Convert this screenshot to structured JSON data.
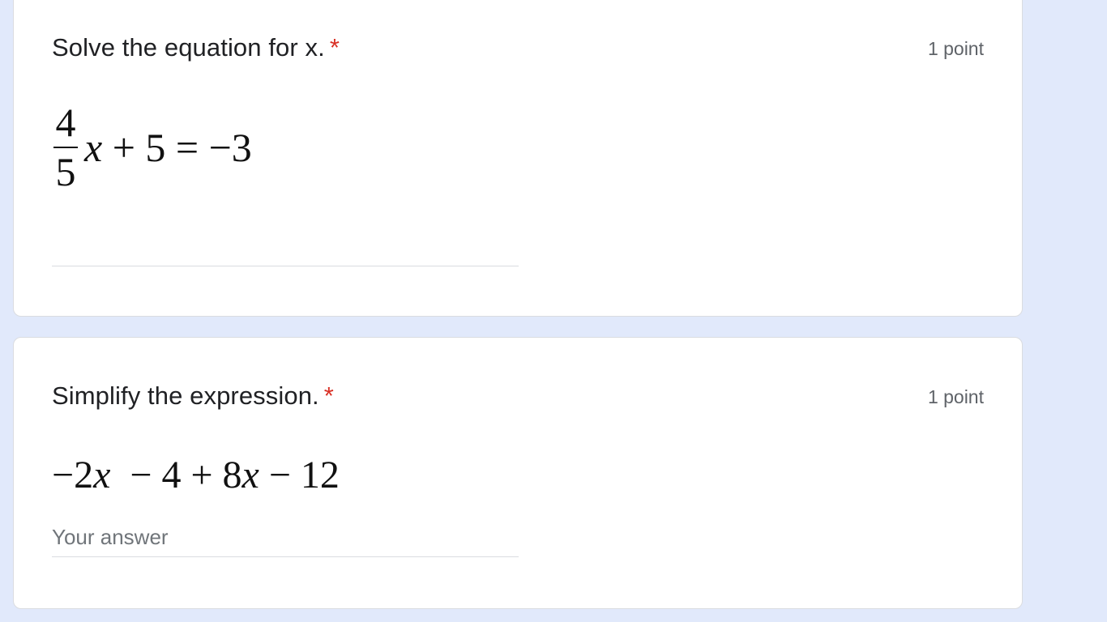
{
  "questions": [
    {
      "title": "Solve the equation for x.",
      "required_mark": "*",
      "points": "1 point",
      "math": {
        "numerator": "4",
        "denominator": "5",
        "rest_var": "x",
        "rest_tail": " + 5 = −3"
      },
      "answer": {
        "value": "",
        "placeholder": ""
      }
    },
    {
      "title": "Simplify the expression.",
      "required_mark": "*",
      "points": "1 point",
      "math": {
        "part1": "−2",
        "var1": "x",
        "part2": "  − 4 + 8",
        "var2": "x",
        "part3": " − 12"
      },
      "answer": {
        "value": "",
        "placeholder": "Your answer"
      }
    }
  ],
  "colors": {
    "page_background": "#e1e9fb",
    "card_background": "#ffffff",
    "required_star": "#d93025",
    "secondary_text": "#5f6368"
  }
}
